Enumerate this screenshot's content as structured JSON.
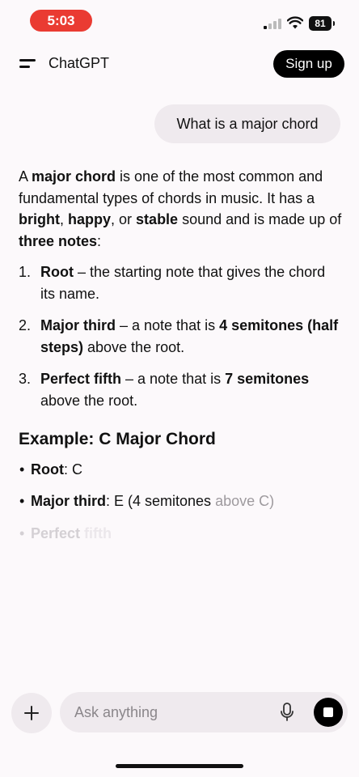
{
  "status_bar": {
    "time": "5:03",
    "battery": "81"
  },
  "header": {
    "title": "ChatGPT",
    "signup_label": "Sign up"
  },
  "user_message": "What is a major chord",
  "response": {
    "intro": {
      "t1": "A ",
      "b1": "major chord",
      "t2": " is one of the most common and fundamental types of chords in music. It has a ",
      "b2": "bright",
      "t3": ", ",
      "b3": "happy",
      "t4": ", or ",
      "b4": "stable",
      "t5": " sound and is made up of ",
      "b5": "three notes",
      "t6": ":"
    },
    "list": [
      {
        "num": "1.",
        "term": "Root",
        "t1": " – the starting note that gives the chord its name.",
        "b": "",
        "t2": ""
      },
      {
        "num": "2.",
        "term": "Major third",
        "t1": " – a note that is ",
        "b": "4 semitones (half steps)",
        "t2": " above the root."
      },
      {
        "num": "3.",
        "term": "Perfect fifth",
        "t1": " – a note that is ",
        "b": "7 semitones",
        "t2": " above the root."
      }
    ],
    "example_heading": "Example: C Major Chord",
    "example_items": [
      {
        "bullet": "•",
        "term": "Root",
        "rest": ": C"
      },
      {
        "bullet": "•",
        "term": "Major third",
        "rest_a": ": E (4 semitones ",
        "rest_b": "above C)"
      },
      {
        "bullet": "•",
        "term_a": "Perfect ",
        "term_b": "fifth"
      }
    ]
  },
  "composer": {
    "placeholder": "Ask anything"
  }
}
